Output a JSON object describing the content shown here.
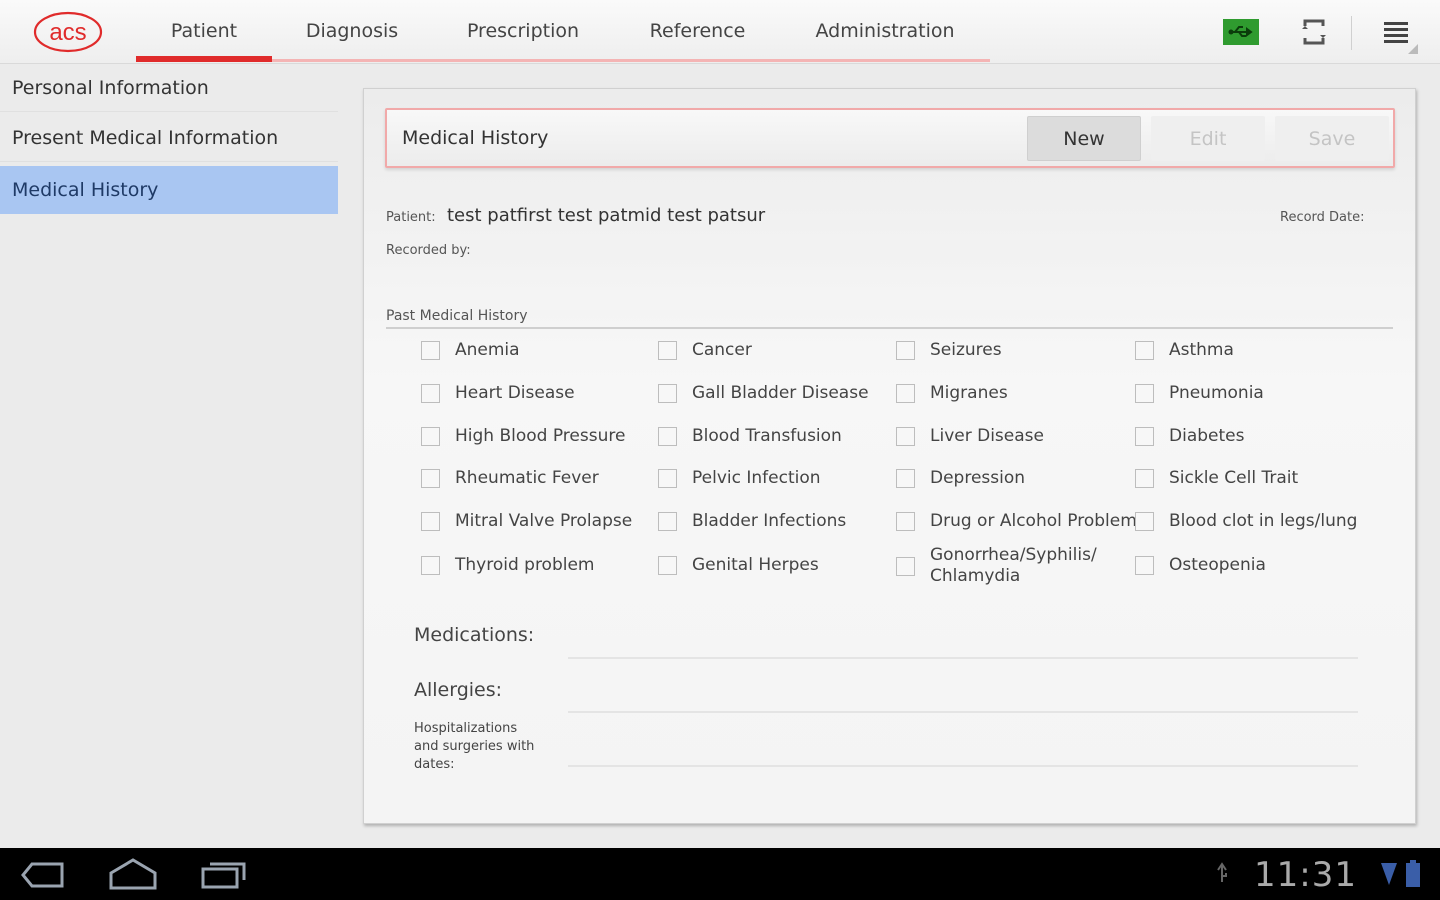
{
  "app": {
    "logo_text": "acs"
  },
  "tabs": [
    {
      "label": "Patient",
      "active": true
    },
    {
      "label": "Diagnosis",
      "active": false
    },
    {
      "label": "Prescription",
      "active": false
    },
    {
      "label": "Reference",
      "active": false
    },
    {
      "label": "Administration",
      "active": false
    }
  ],
  "toolbar_icons": [
    "usb-icon",
    "rotate-icon",
    "overflow-menu-icon"
  ],
  "sidebar": {
    "items": [
      {
        "label": "Personal Information",
        "active": false
      },
      {
        "label": "Present Medical Information",
        "active": false
      },
      {
        "label": "Medical History",
        "active": true
      }
    ]
  },
  "panel": {
    "header": {
      "title": "Medical History",
      "new_label": "New",
      "edit_label": "Edit",
      "save_label": "Save"
    },
    "patient_label": "Patient:",
    "patient_name": "test patfirst test patmid test patsur",
    "recorded_by_label": "Recorded by:",
    "record_date_label": "Record Date:",
    "past_history_title": "Past Medical History",
    "conditions": [
      [
        "Anemia",
        "Cancer",
        "Seizures",
        "Asthma"
      ],
      [
        "Heart Disease",
        "Gall Bladder Disease",
        "Migranes",
        "Pneumonia"
      ],
      [
        "High Blood Pressure",
        "Blood Transfusion",
        "Liver Disease",
        "Diabetes"
      ],
      [
        "Rheumatic Fever",
        "Pelvic Infection",
        "Depression",
        "Sickle Cell Trait"
      ],
      [
        "Mitral Valve Prolapse",
        "Bladder Infections",
        "Drug or Alcohol Problem",
        "Blood clot in legs/lung"
      ],
      [
        "Thyroid problem",
        "Genital Herpes",
        "Gonorrhea/Syphilis/\nChlamydia",
        "Osteopenia"
      ]
    ],
    "medications_label": "Medications:",
    "allergies_label": "Allergies:",
    "hospitalizations_label": "Hospitalizations\nand surgeries with\ndates:"
  },
  "system": {
    "clock": "11:31"
  },
  "colors": {
    "accent_red": "#e02b2b",
    "tab_underline": "#f4b4b4",
    "sidebar_selected": "#a9c6f2",
    "usb_green": "#2f9b2f"
  }
}
